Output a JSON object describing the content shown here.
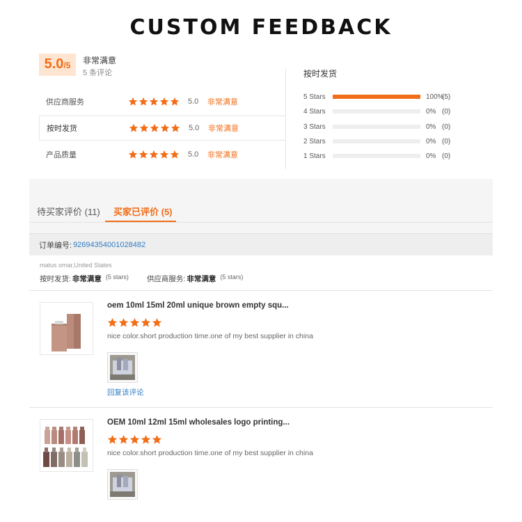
{
  "title": "CUSTOM FEEDBACK",
  "summary": {
    "score": "5.0",
    "score_max": "/5",
    "overall_label": "非常满意",
    "review_count": "5 条评论"
  },
  "dimensions": [
    {
      "label": "供应商服务",
      "score": "5.0",
      "text": "非常满意",
      "stars": 5
    },
    {
      "label": "按时发货",
      "score": "5.0",
      "text": "非常满意",
      "stars": 5
    },
    {
      "label": "产品质量",
      "score": "5.0",
      "text": "非常满意",
      "stars": 5
    }
  ],
  "distribution": {
    "title": "按时发货",
    "rows": [
      {
        "label": "5 Stars",
        "fraction": 1.0,
        "percent": "100%",
        "count": "(5)"
      },
      {
        "label": "4 Stars",
        "fraction": 0,
        "percent": "0%",
        "count": "(0)"
      },
      {
        "label": "3 Stars",
        "fraction": 0,
        "percent": "0%",
        "count": "(0)"
      },
      {
        "label": "2 Stars",
        "fraction": 0,
        "percent": "0%",
        "count": "(0)"
      },
      {
        "label": "1 Stars",
        "fraction": 0,
        "percent": "0%",
        "count": "(0)"
      }
    ]
  },
  "tabs": [
    {
      "label": "待买家评价 (11)",
      "active": false
    },
    {
      "label": "买家已评价 (5)",
      "active": true
    }
  ],
  "order": {
    "label": "订单编号:",
    "number": "92694354001028482"
  },
  "buyer": {
    "name": "matus omar,United States",
    "rating1_label": "按时发货:",
    "rating1_value": "非常满意",
    "rating1_stars": "(5 stars)",
    "rating2_label": "供应商服务:",
    "rating2_value": "非常满意",
    "rating2_stars": "(5 stars)"
  },
  "items": [
    {
      "title": "oem 10ml 15ml 20ml unique brown empty squ...",
      "stars": 5,
      "comment": "nice color.short production time.one of my best supplier in china",
      "reply": "回复该评论"
    },
    {
      "title": "OEM 10ml 12ml 15ml wholesales logo printing...",
      "stars": 5,
      "comment": "nice color.short production time.one of my best supplier in china"
    }
  ],
  "colors": {
    "accent": "#f26d17",
    "link": "#2e7cc4",
    "star": "#f26d17"
  },
  "icons": [
    "star-icon"
  ]
}
